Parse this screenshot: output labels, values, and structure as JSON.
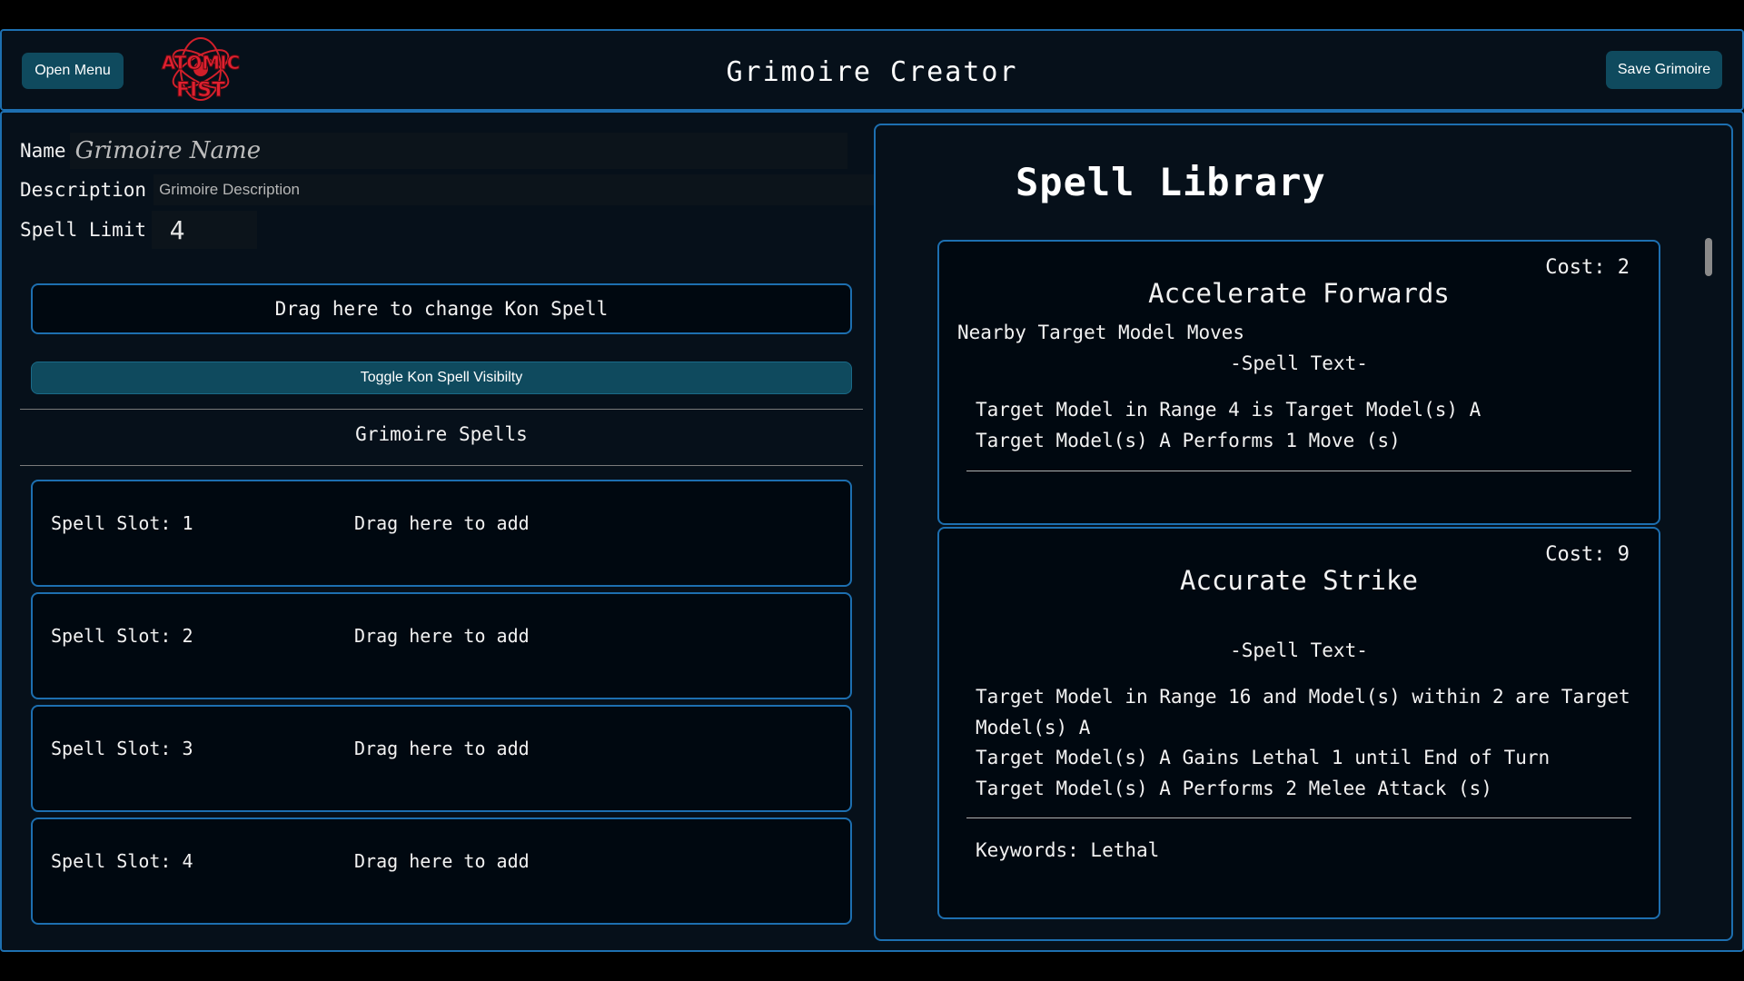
{
  "header": {
    "open_menu": "Open Menu",
    "title": "Grimoire Creator",
    "save": "Save Grimoire",
    "logo_text": "Atomic Fist"
  },
  "form": {
    "name_label": "Name",
    "name_placeholder": "Grimoire Name",
    "description_label": "Description",
    "description_placeholder": "Grimoire Description",
    "spell_limit_label": "Spell Limit",
    "spell_limit_value": "4",
    "kon_drop": "Drag here to change Kon Spell",
    "kon_toggle": "Toggle Kon Spell Visibilty"
  },
  "grimoire_spells": {
    "title": "Grimoire Spells",
    "slots": [
      {
        "label": "Spell Slot: 1",
        "hint": "Drag here to add"
      },
      {
        "label": "Spell Slot: 2",
        "hint": "Drag here to add"
      },
      {
        "label": "Spell Slot: 3",
        "hint": "Drag here to add"
      },
      {
        "label": "Spell Slot: 4",
        "hint": "Drag here to add"
      }
    ]
  },
  "library": {
    "title": "Spell Library",
    "spell_text_heading": "-Spell Text-",
    "cards": [
      {
        "cost": "Cost: 2",
        "name": "Accelerate Forwards",
        "subtitle": "Nearby Target Model Moves",
        "lines": [
          "Target Model in Range 4 is Target Model(s) A",
          "Target Model(s) A Performs 1 Move (s)"
        ],
        "keywords": ""
      },
      {
        "cost": "Cost: 9",
        "name": "Accurate Strike",
        "subtitle": "",
        "lines": [
          "Target Model in Range 16 and Model(s) within 2 are Target Model(s) A",
          "Target Model(s) A Gains Lethal 1 until End of Turn",
          "Target Model(s) A Performs 2 Melee Attack (s)"
        ],
        "keywords": "Keywords: Lethal"
      }
    ]
  },
  "colors": {
    "accent_border": "#1d6fb0",
    "button_teal": "#0f4a5e",
    "background": "#06101a",
    "logo_red": "#d11f2a"
  }
}
